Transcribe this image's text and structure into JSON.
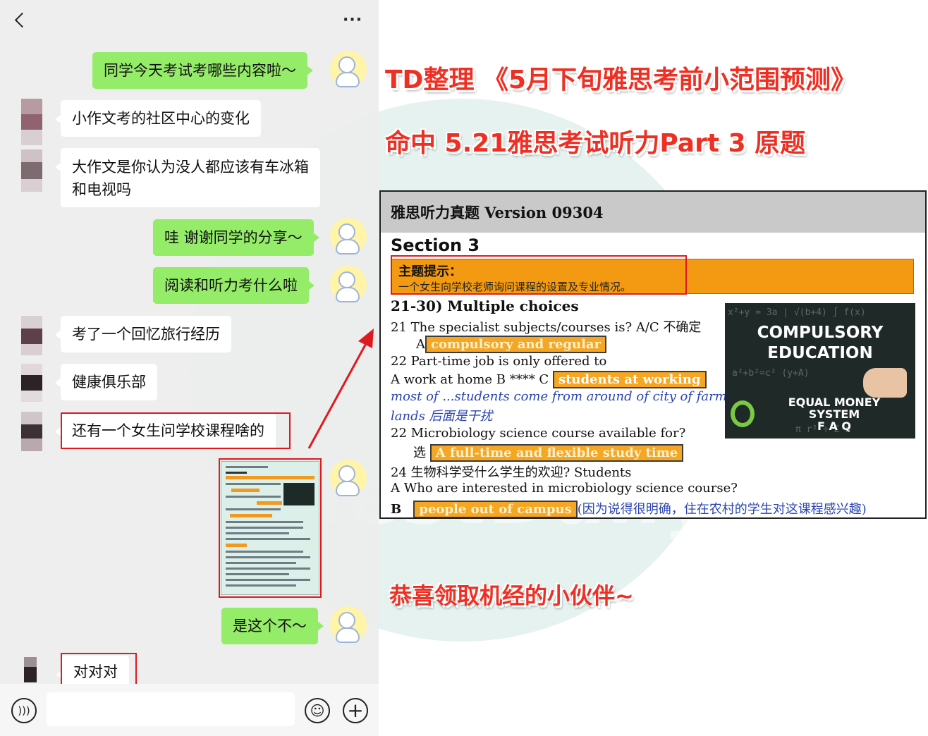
{
  "colors": {
    "accent_red": "#ee3024",
    "bubble_green": "#95ec69",
    "highlight_orange": "#f39a12"
  },
  "chat": {
    "topbar": {
      "back_icon": "chevron-left-icon",
      "more_label": "···"
    },
    "messages": [
      {
        "side": "right",
        "text": "同学今天考试考哪些内容啦～"
      },
      {
        "side": "left",
        "text": "小作文考的社区中心的变化"
      },
      {
        "side": "left",
        "text": "大作文是你认为没人都应该有车冰箱和电视吗"
      },
      {
        "side": "right",
        "text": "哇 谢谢同学的分享～"
      },
      {
        "side": "right",
        "text": "阅读和听力考什么啦"
      },
      {
        "side": "left",
        "text": "考了一个回忆旅行经历"
      },
      {
        "side": "left",
        "text": "健康俱乐部"
      },
      {
        "side": "left",
        "text": "还有一个女生问学校课程啥的"
      },
      {
        "side": "right",
        "text": "是这个不～"
      },
      {
        "side": "left",
        "text": "对对对"
      }
    ],
    "input": {
      "voice_icon": "voice-icon",
      "emoji_icon": "emoji-icon",
      "plus_icon": "plus-icon"
    }
  },
  "headlines": {
    "line1": "TD整理 《5月下旬雅思考前小范围预测》",
    "line2": "命中 5.21雅思考试听力Part 3 原题",
    "tagline": "恭喜领取机经的小伙伴~"
  },
  "watermark": {
    "text": "TestDaily"
  },
  "document": {
    "header": "雅思听力真题 Version 09304",
    "section": "Section 3",
    "topic_label": "主题提示：",
    "topic_text": "一个女生向学校老师询问课程的设置及专业情况。",
    "heading": "21-30) Multiple choices",
    "q21": "21   The specialist subjects/courses is? A/C  不确定",
    "q21_prefix": "A",
    "q21_answer": "compulsory and regular",
    "q22": "22  Part-time job is only offered to",
    "q22_options": "A work at home   B ****   C",
    "q22_answer": "students at working",
    "note_line1": "most of ...students come from around of city of farm",
    "note_line2": "lands 后面是干扰",
    "q23": "22   Microbiology science course available for?",
    "q23_prefix": "选",
    "q23_answer": "A full-time and flexible study time",
    "q24": "24  生物科学受什么学生的欢迎? Students",
    "q24_a": "A    Who are interested in microbiology science course?",
    "q24_b_label": "B",
    "q24_b_answer": "people out of campus",
    "q24_b_note": "(因为说得很明确，住在农村的学生对这课程感兴趣)",
    "image": {
      "title_line1": "COMPULSORY",
      "title_line2": "EDUCATION",
      "sub_line1": "EQUAL MONEY",
      "sub_line2": "SYSTEM",
      "sub_line3": "F A Q"
    }
  }
}
